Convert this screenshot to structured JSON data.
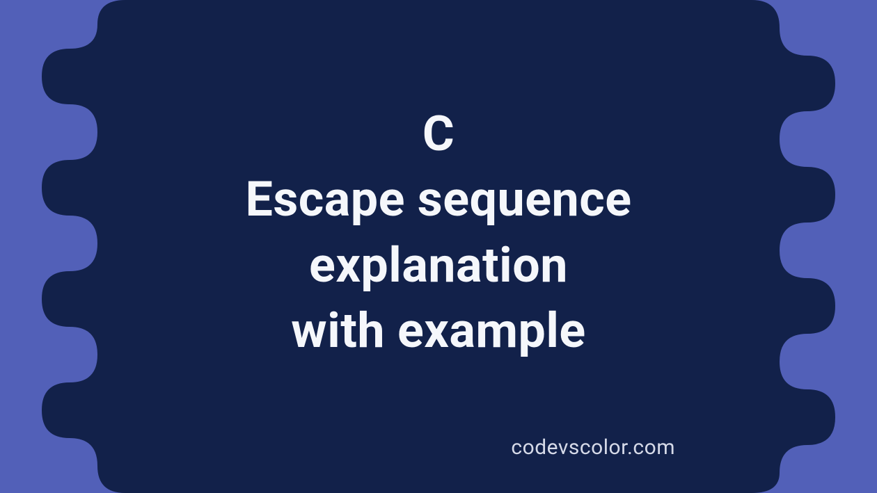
{
  "title": {
    "line1": "C",
    "line2": "Escape sequence",
    "line3": "explanation",
    "line4": "with example"
  },
  "watermark": "codevscolor.com",
  "colors": {
    "background": "#5260b8",
    "blob": "#12214a",
    "text": "#f5f7fb",
    "watermark": "#d6dae8"
  }
}
